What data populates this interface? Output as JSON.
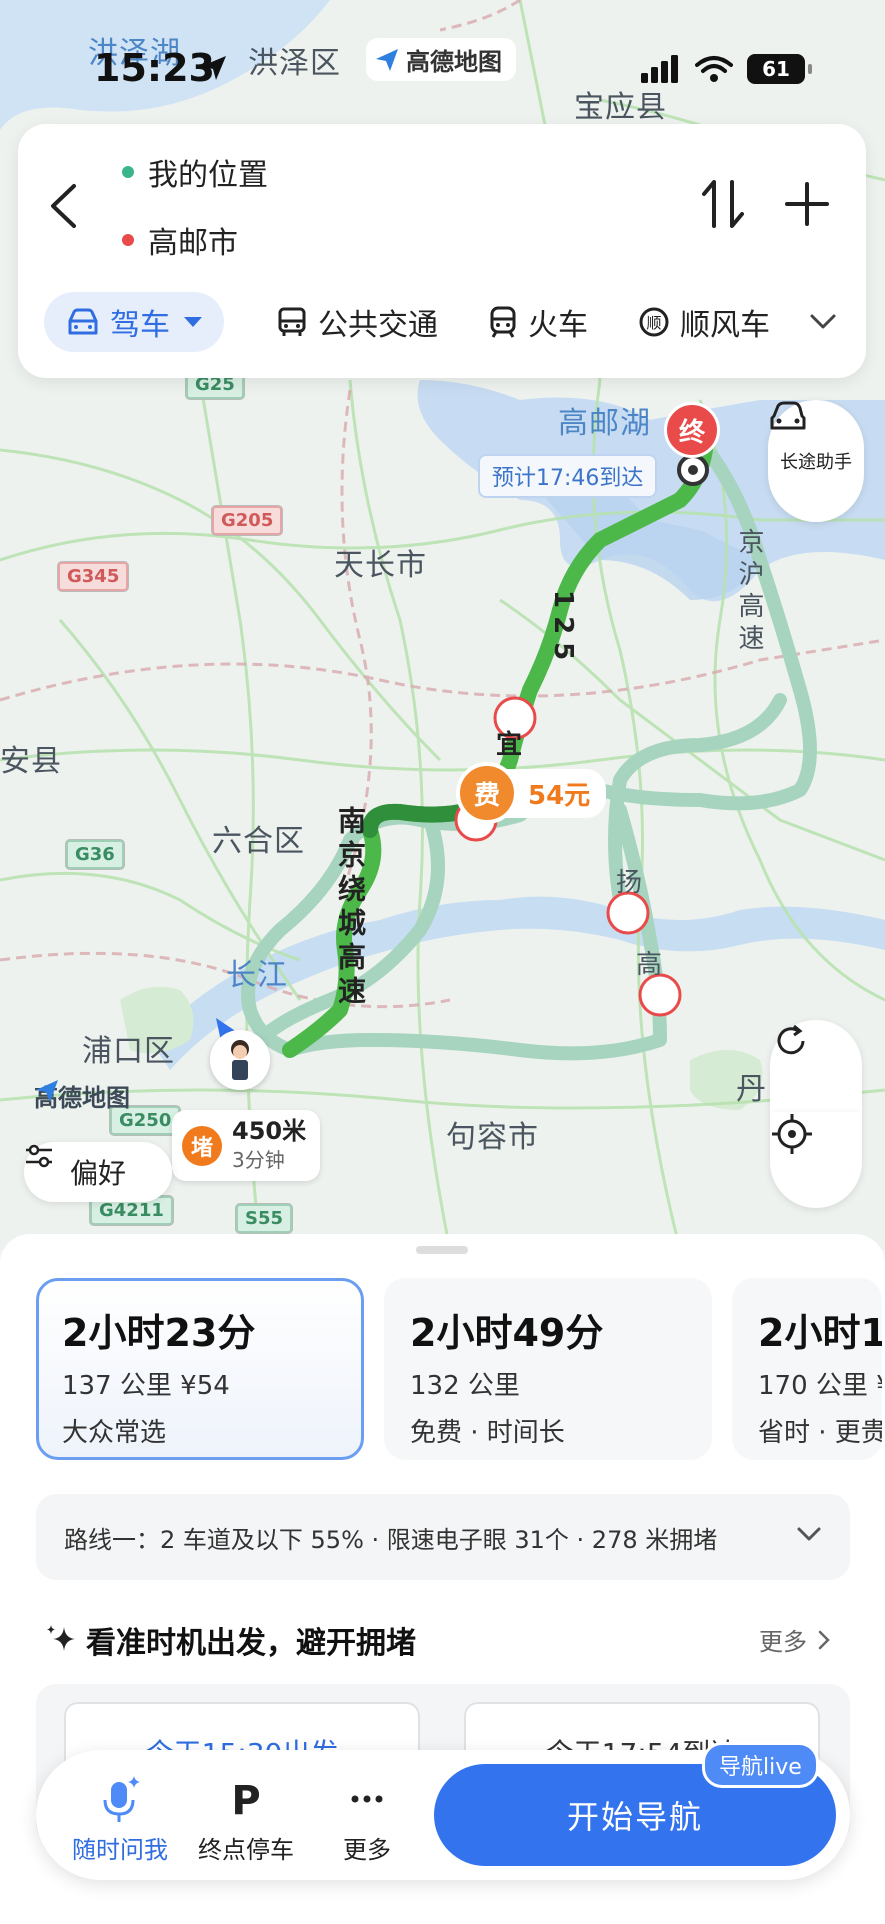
{
  "status_bar": {
    "time": "15:23",
    "battery": "61"
  },
  "top_brand": "高德地图",
  "search": {
    "origin": "我的位置",
    "destination": "高邮市",
    "modes": [
      {
        "label": "驾车",
        "active": true
      },
      {
        "label": "公共交通"
      },
      {
        "label": "火车"
      },
      {
        "label": "顺风车"
      }
    ]
  },
  "map": {
    "labels": {
      "hongze_lake": "洪泽湖",
      "hongze_district": "洪泽区",
      "baoying": "宝应县",
      "gaoyou_lake": "高邮湖",
      "tianchang": "天长市",
      "an_county": "安县",
      "luhe": "六合区",
      "changjiang": "长江",
      "pukou": "浦口区",
      "jurong": "句容市",
      "dan": "丹",
      "yang": "扬",
      "gao": "高",
      "jinghu": "京沪高速",
      "nanjing_ring": "南京绕城高速",
      "route_num": "125",
      "expressway_char": "宜"
    },
    "shields": [
      "G25",
      "G205",
      "G345",
      "G36",
      "G250",
      "S55",
      "G4211"
    ],
    "eta_tag": "预计17:46到达",
    "end_marker": "终",
    "long_trip_label": "长途助手",
    "toll": {
      "icon": "费",
      "price": "54元"
    },
    "jam": {
      "icon": "堵",
      "distance": "450米",
      "duration": "3分钟"
    },
    "preference_label": "偏好",
    "map_brand": "高德地图"
  },
  "routes": [
    {
      "time": "2小时23分",
      "meta": "137 公里  ¥54",
      "tag": "大众常选"
    },
    {
      "time": "2小时49分",
      "meta": "132 公里",
      "tag": "免费 · 时间长"
    },
    {
      "time": "2小时1",
      "meta": "170 公里  ¥",
      "tag": "省时 · 更贵"
    }
  ],
  "route_desc": "路线一：2 车道及以下 55% · 限速电子眼 31个 · 278 米拥堵",
  "timing": {
    "title": "看准时机出发，避开拥堵",
    "more": "更多",
    "slot_left": "今天15:30出发",
    "slot_right": "今天17:54到达"
  },
  "bottom_bar": {
    "ask": "随时问我",
    "parking": "终点停车",
    "more": "更多",
    "navigate": "开始导航",
    "live": "导航live"
  },
  "colors": {
    "accent_blue": "#3374ee",
    "route_green": "#4cb84a",
    "route_dark_green": "#2f8f3a",
    "alt_route": "#9ecfb8",
    "toll_orange": "#f08a2c",
    "end_red": "#e94a4a"
  }
}
